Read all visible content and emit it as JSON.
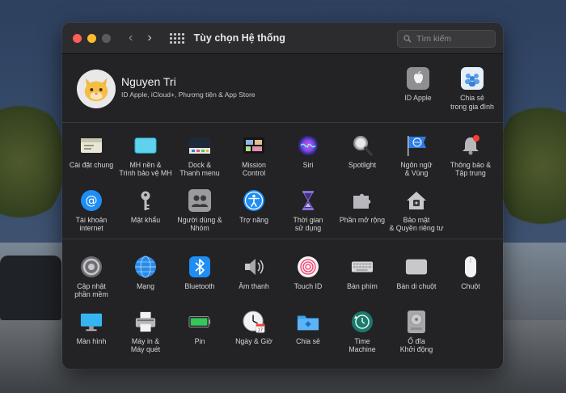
{
  "window": {
    "title": "Tùy chọn Hệ thống",
    "search_placeholder": "Tìm kiếm",
    "nav_back": "‹",
    "nav_forward": "›"
  },
  "profile": {
    "name": "Nguyen Tri",
    "subtitle": "ID Apple, iCloud+, Phương tiện & App Store",
    "items": [
      {
        "label": "ID Apple"
      },
      {
        "label": "Chia sẻ\ntrong gia đình"
      }
    ]
  },
  "row1": [
    {
      "label": "Cài đặt chung",
      "icon": "general-icon"
    },
    {
      "label": "MH nền &\nTrình bảo vệ MH",
      "icon": "desktop-screensaver-icon"
    },
    {
      "label": "Dock &\nThanh menu",
      "icon": "dock-icon"
    },
    {
      "label": "Mission\nControl",
      "icon": "mission-control-icon"
    },
    {
      "label": "Siri",
      "icon": "siri-icon"
    },
    {
      "label": "Spotlight",
      "icon": "spotlight-icon"
    },
    {
      "label": "Ngôn ngữ\n& Vùng",
      "icon": "language-region-icon"
    },
    {
      "label": "Thông báo &\nTập trung",
      "icon": "notifications-icon"
    }
  ],
  "row2": [
    {
      "label": "Tài khoản\ninternet",
      "icon": "internet-accounts-icon"
    },
    {
      "label": "Mật khẩu",
      "icon": "passwords-icon"
    },
    {
      "label": "Người dùng &\nNhóm",
      "icon": "users-groups-icon"
    },
    {
      "label": "Trợ năng",
      "icon": "accessibility-icon"
    },
    {
      "label": "Thời gian\nsử dụng",
      "icon": "screen-time-icon"
    },
    {
      "label": "Phần mở rộng",
      "icon": "extensions-icon"
    },
    {
      "label": "Bảo mật\n& Quyền riêng tư",
      "icon": "security-privacy-icon"
    }
  ],
  "row3": [
    {
      "label": "Cập nhật\nphần mềm",
      "icon": "software-update-icon"
    },
    {
      "label": "Mạng",
      "icon": "network-icon"
    },
    {
      "label": "Bluetooth",
      "icon": "bluetooth-icon"
    },
    {
      "label": "Âm thanh",
      "icon": "sound-icon"
    },
    {
      "label": "Touch ID",
      "icon": "touch-id-icon"
    },
    {
      "label": "Bàn phím",
      "icon": "keyboard-icon"
    },
    {
      "label": "Bàn di chuột",
      "icon": "trackpad-icon"
    },
    {
      "label": "Chuột",
      "icon": "mouse-icon"
    }
  ],
  "row4": [
    {
      "label": "Màn hình",
      "icon": "displays-icon"
    },
    {
      "label": "Máy in &\nMáy quét",
      "icon": "printers-scanners-icon"
    },
    {
      "label": "Pin",
      "icon": "battery-icon"
    },
    {
      "label": "Ngày & Giờ",
      "icon": "date-time-icon"
    },
    {
      "label": "Chia sẻ",
      "icon": "sharing-icon"
    },
    {
      "label": "Time\nMachine",
      "icon": "time-machine-icon"
    },
    {
      "label": "Ổ đĩa\nKhởi động",
      "icon": "startup-disk-icon"
    }
  ],
  "colors": {
    "window_bg": "#1f1f21",
    "titlebar_bg": "#2c2c2e",
    "accent_blue": "#0a84ff"
  }
}
